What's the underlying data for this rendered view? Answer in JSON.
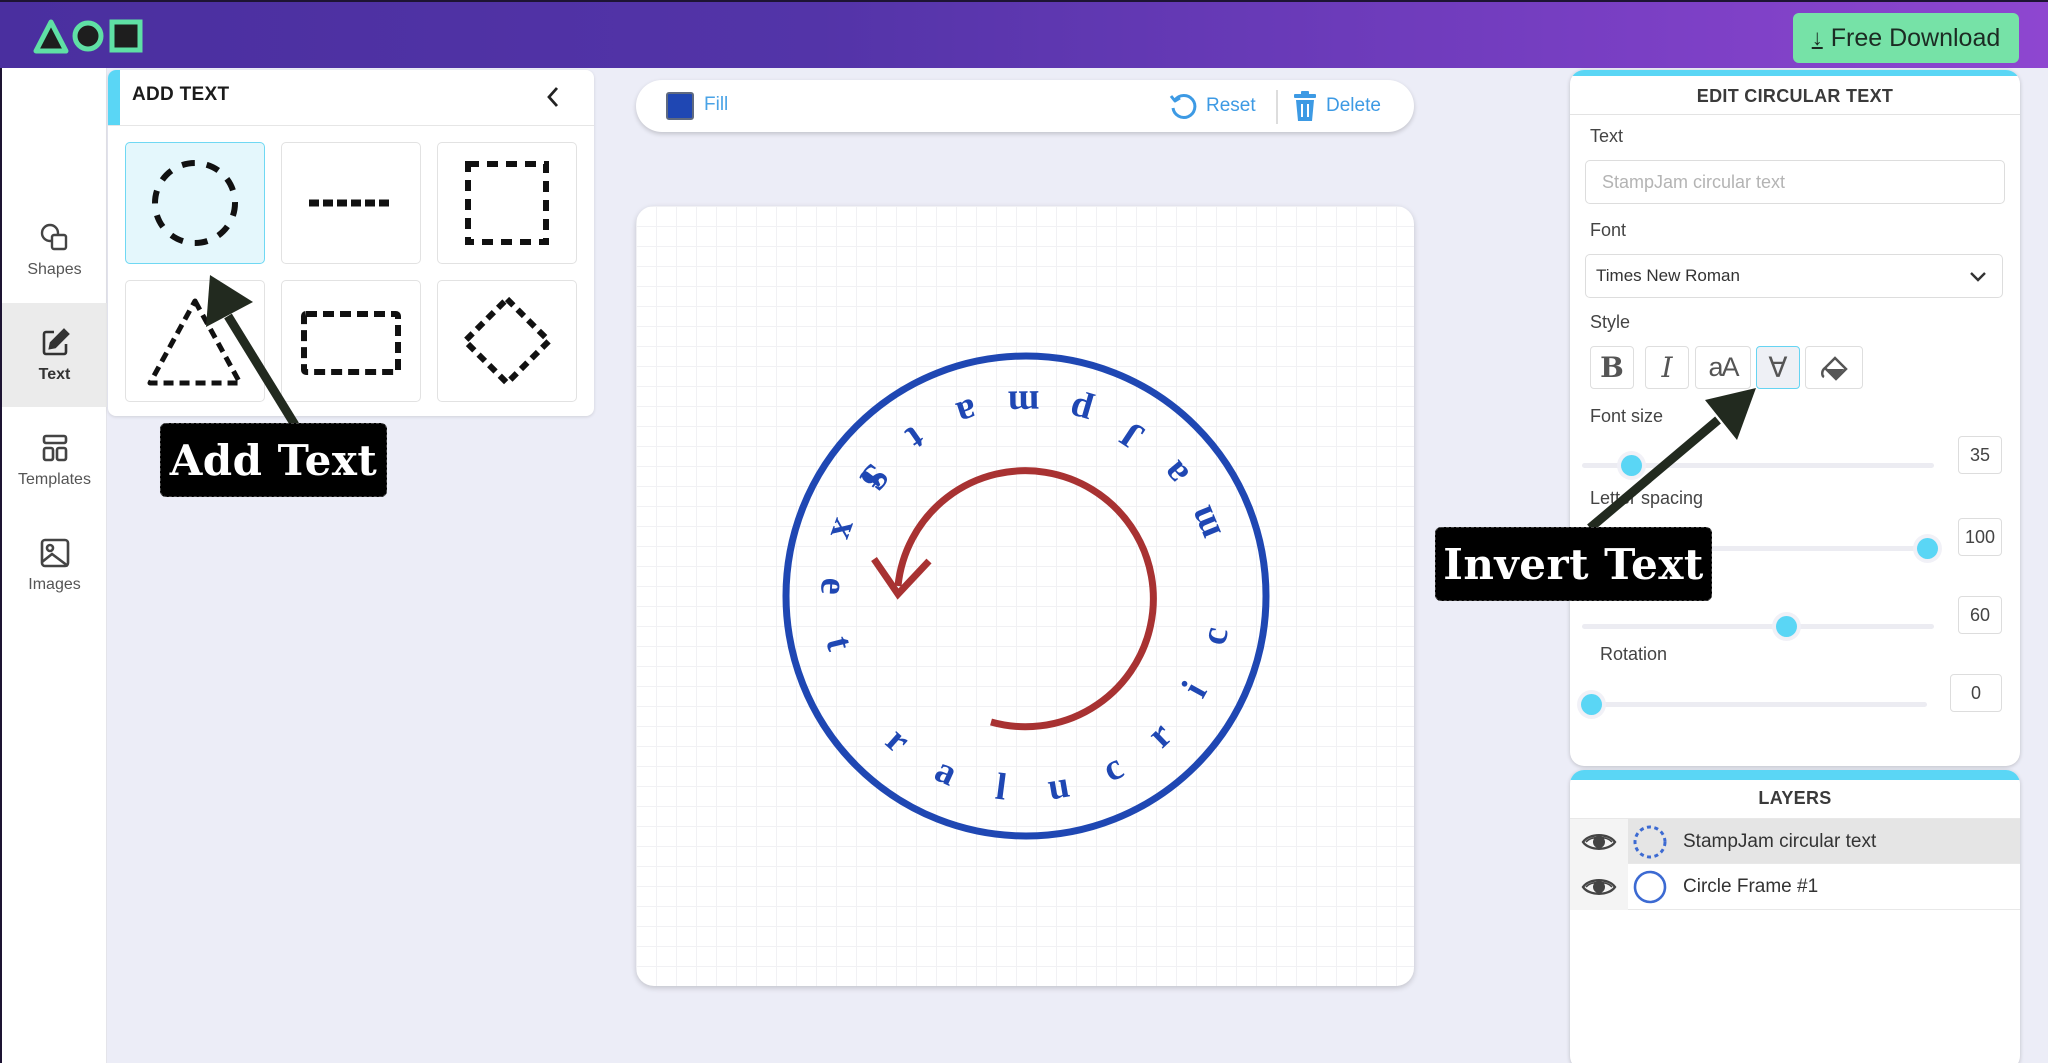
{
  "header": {
    "logo_icon": "triangle-circle-square-logo",
    "download_button": {
      "icon": "download-icon",
      "label": "Free Download"
    },
    "colors": {
      "gradient_start": "#4a2f9f",
      "gradient_end": "#8e46d0",
      "download_bg": "#76e2a7"
    }
  },
  "sidebar": {
    "items": [
      {
        "label": "Shapes",
        "icon": "shapes-icon",
        "active": false
      },
      {
        "label": "Text",
        "icon": "edit-icon",
        "active": true
      },
      {
        "label": "Templates",
        "icon": "templates-icon",
        "active": false
      },
      {
        "label": "Images",
        "icon": "image-icon",
        "active": false
      }
    ]
  },
  "add_text_panel": {
    "title": "ADD TEXT",
    "collapse_icon": "chevron-left-icon",
    "shapes": [
      {
        "name": "dashed-circle",
        "selected": true
      },
      {
        "name": "dashed-line",
        "selected": false
      },
      {
        "name": "dashed-square",
        "selected": false
      },
      {
        "name": "dashed-triangle",
        "selected": false
      },
      {
        "name": "dashed-rectangle",
        "selected": false
      },
      {
        "name": "dashed-diamond",
        "selected": false
      }
    ]
  },
  "toolbar": {
    "fill_label": "Fill",
    "fill_color": "#1f47b3",
    "reset_label": "Reset",
    "delete_label": "Delete"
  },
  "canvas": {
    "circular_text": "StampJam circular text",
    "text_color": "#1f47b3",
    "frame_color": "#1f47b3",
    "inverted": true,
    "direction_arrow_color": "#a83232"
  },
  "edit_panel": {
    "title": "EDIT CIRCULAR TEXT",
    "text_label": "Text",
    "text_placeholder": "StampJam circular text",
    "font_label": "Font",
    "font_value": "Times New Roman",
    "style_label": "Style",
    "style_buttons": [
      {
        "name": "bold",
        "glyph": "B",
        "active": false
      },
      {
        "name": "italic",
        "glyph": "I",
        "active": false
      },
      {
        "name": "case",
        "glyph": "aA",
        "active": false
      },
      {
        "name": "invert",
        "glyph": "∀",
        "active": true
      },
      {
        "name": "fill-bucket",
        "glyph": "",
        "active": false
      }
    ],
    "font_size_label": "Font size",
    "font_size_value": "35",
    "font_size_fraction": 0.14,
    "letter_spacing_label": "Letter spacing",
    "letter_spacing_value": "100",
    "letter_spacing_fraction": 0.98,
    "third_slider_value": "60",
    "third_slider_fraction": 0.58,
    "rotation_label": "Rotation",
    "rotation_value": "0",
    "rotation_fraction": 0.0
  },
  "layers_panel": {
    "title": "LAYERS",
    "layers": [
      {
        "name": "StampJam circular text",
        "icon": "dashed-circle-icon",
        "visible": true,
        "selected": true
      },
      {
        "name": "Circle Frame #1",
        "icon": "circle-icon",
        "visible": true,
        "selected": false
      }
    ]
  },
  "annotations": {
    "add_text_callout": "Add Text",
    "invert_text_callout": "Invert Text"
  }
}
